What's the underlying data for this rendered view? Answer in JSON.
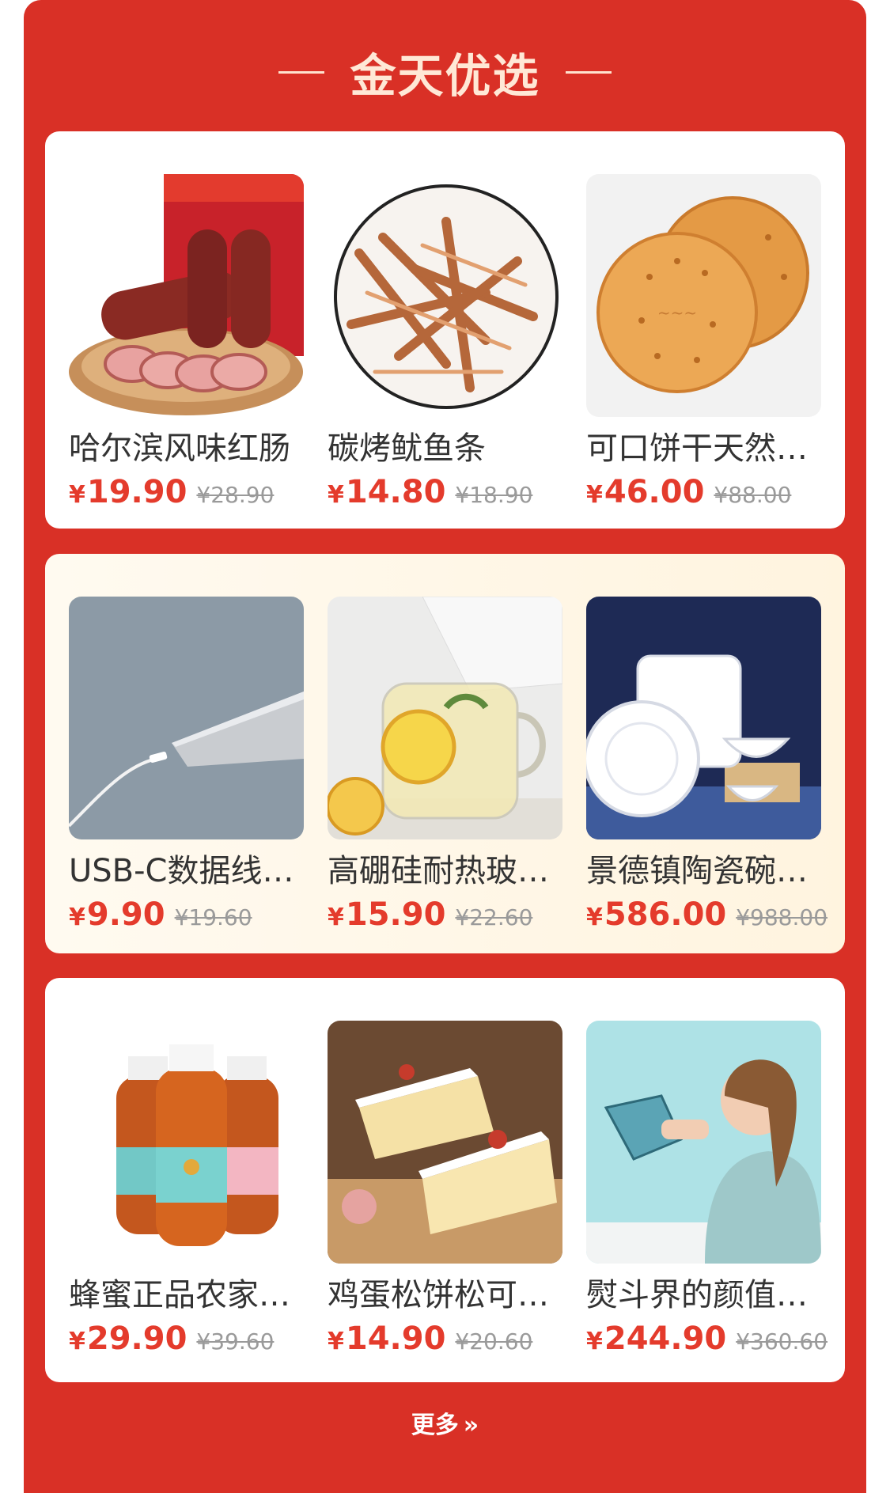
{
  "header": {
    "title": "金天优选"
  },
  "currency": "¥",
  "sections": [
    {
      "products": [
        {
          "name": "哈尔滨风味红肠",
          "price": "19.90",
          "original_price": "¥28.90",
          "image": "sausage-image"
        },
        {
          "name": "碳烤鱿鱼条",
          "price": "14.80",
          "original_price": "¥18.90",
          "image": "squid-strips-image"
        },
        {
          "name": "可口饼干天然…",
          "price": "46.00",
          "original_price": "¥88.00",
          "image": "biscuit-image"
        }
      ]
    },
    {
      "products": [
        {
          "name": "USB-C数据线…",
          "price": "9.90",
          "original_price": "¥19.60",
          "image": "usb-cable-image"
        },
        {
          "name": "高硼硅耐热玻…",
          "price": "15.90",
          "original_price": "¥22.60",
          "image": "glass-cup-image"
        },
        {
          "name": "景德镇陶瓷碗…",
          "price": "586.00",
          "original_price": "¥988.00",
          "image": "ceramic-bowls-image"
        }
      ]
    },
    {
      "products": [
        {
          "name": "蜂蜜正品农家…",
          "price": "29.90",
          "original_price": "¥39.60",
          "image": "honey-image"
        },
        {
          "name": "鸡蛋松饼松可…",
          "price": "14.90",
          "original_price": "¥20.60",
          "image": "cake-image"
        },
        {
          "name": "熨斗界的颜值…",
          "price": "244.90",
          "original_price": "¥360.60",
          "image": "iron-image"
        }
      ]
    }
  ],
  "footer": {
    "more_label": "更多"
  },
  "colors": {
    "panel": "#d93026",
    "price": "#e43b2c",
    "title": "#ffe8d6"
  }
}
